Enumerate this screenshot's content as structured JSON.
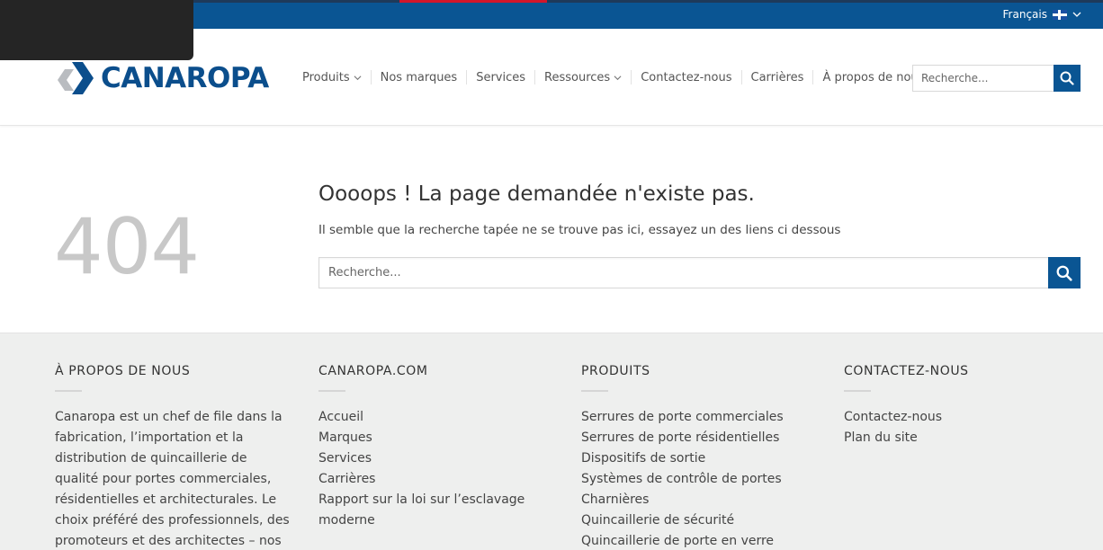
{
  "topbar": {
    "language": "Français"
  },
  "header": {
    "logo_text": "CANAROPA",
    "nav": [
      {
        "label": "Produits",
        "dropdown": true
      },
      {
        "label": "Nos marques",
        "dropdown": false
      },
      {
        "label": "Services",
        "dropdown": false
      },
      {
        "label": "Ressources",
        "dropdown": true
      },
      {
        "label": "Contactez-nous",
        "dropdown": false
      },
      {
        "label": "Carrières",
        "dropdown": false
      },
      {
        "label": "À propos de nous",
        "dropdown": false
      }
    ],
    "search_placeholder": "Recherche..."
  },
  "error": {
    "code": "404",
    "title": "Oooops ! La page demandée n'existe pas.",
    "message": "Il semble que la recherche tapée ne se trouve pas ici, essayez un des liens ci dessous",
    "search_placeholder": "Recherche..."
  },
  "footer": {
    "about": {
      "heading": "À PROPOS DE NOUS",
      "text": "Canaropa est un chef de file dans la fabrication, l’importation et la distribution de quincaillerie de qualité pour portes commerciales, résidentielles et architecturales. Le choix préféré des professionnels, des promoteurs et des architectes – nos"
    },
    "site": {
      "heading": "CANAROPA.COM",
      "links": [
        "Accueil",
        "Marques",
        "Services",
        "Carrières",
        "Rapport sur la loi sur l’esclavage moderne"
      ]
    },
    "products": {
      "heading": "PRODUITS",
      "links": [
        "Serrures de porte commerciales",
        "Serrures de porte résidentielles",
        "Dispositifs de sortie",
        "Systèmes de contrôle de portes",
        "Charnières",
        "Quincaillerie de sécurité",
        "Quincaillerie de porte en verre"
      ]
    },
    "contact": {
      "heading": "CONTACTEZ-NOUS",
      "links": [
        "Contactez-nous",
        "Plan du site"
      ]
    }
  },
  "colors": {
    "brand_blue": "#0a5593",
    "logo_blue": "#0b4e8c",
    "accent_red": "#d3162b",
    "footer_bg": "#eeefee"
  }
}
